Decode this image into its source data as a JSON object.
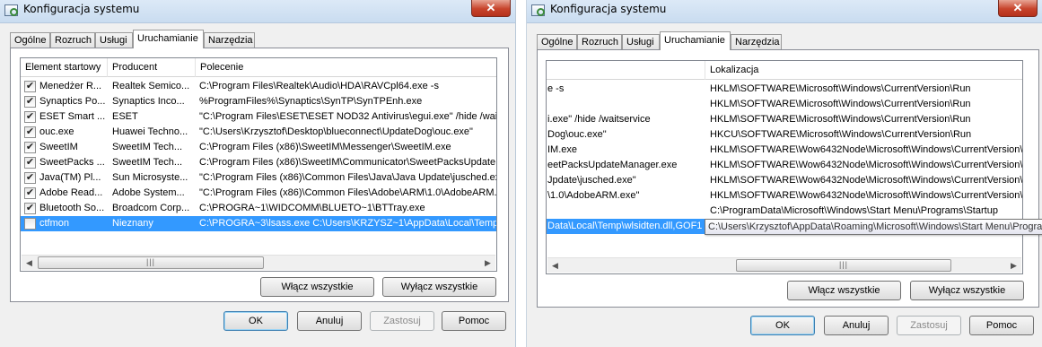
{
  "window": {
    "title": "Konfiguracja systemu",
    "close_glyph": "✕"
  },
  "tabs": [
    "Ogólne",
    "Rozruch",
    "Usługi",
    "Uruchamianie",
    "Narzędzia"
  ],
  "active_tab": "Uruchamianie",
  "columns": {
    "startup_item": "Element startowy",
    "manufacturer": "Producent",
    "command": "Polecenie",
    "location": "Lokalizacja"
  },
  "rows": [
    {
      "name": "Menedżer R...",
      "manufacturer": "Realtek Semico...",
      "command": "C:\\Program Files\\Realtek\\Audio\\HDA\\RAVCpl64.exe -s",
      "command_tail": "e -s",
      "location": "HKLM\\SOFTWARE\\Microsoft\\Windows\\CurrentVersion\\Run",
      "checked": true
    },
    {
      "name": "Synaptics Po...",
      "manufacturer": "Synaptics Inco...",
      "command": "%ProgramFiles%\\Synaptics\\SynTP\\SynTPEnh.exe",
      "command_tail": "",
      "location": "HKLM\\SOFTWARE\\Microsoft\\Windows\\CurrentVersion\\Run",
      "checked": true
    },
    {
      "name": "ESET Smart ...",
      "manufacturer": "ESET",
      "command": "\"C:\\Program Files\\ESET\\ESET NOD32 Antivirus\\egui.exe\" /hide /waits",
      "command_tail": "i.exe\" /hide /waitservice",
      "location": "HKLM\\SOFTWARE\\Microsoft\\Windows\\CurrentVersion\\Run",
      "checked": true
    },
    {
      "name": "ouc.exe",
      "manufacturer": "Huawei Techno...",
      "command": "\"C:\\Users\\Krzysztof\\Desktop\\blueconnect\\UpdateDog\\ouc.exe\"",
      "command_tail": "Dog\\ouc.exe\"",
      "location": "HKCU\\SOFTWARE\\Microsoft\\Windows\\CurrentVersion\\Run",
      "checked": true
    },
    {
      "name": "SweetIM",
      "manufacturer": "SweetIM Tech...",
      "command": "C:\\Program Files (x86)\\SweetIM\\Messenger\\SweetIM.exe",
      "command_tail": "IM.exe",
      "location": "HKLM\\SOFTWARE\\Wow6432Node\\Microsoft\\Windows\\CurrentVersion\\Ru",
      "checked": true
    },
    {
      "name": "SweetPacks ...",
      "manufacturer": "SweetIM Tech...",
      "command": "C:\\Program Files (x86)\\SweetIM\\Communicator\\SweetPacksUpdateM",
      "command_tail": "eetPacksUpdateManager.exe",
      "location": "HKLM\\SOFTWARE\\Wow6432Node\\Microsoft\\Windows\\CurrentVersion\\Ru",
      "checked": true
    },
    {
      "name": "Java(TM) Pl...",
      "manufacturer": "Sun Microsyste...",
      "command": "\"C:\\Program Files (x86)\\Common Files\\Java\\Java Update\\jusched.exe\"",
      "command_tail": "Jpdate\\jusched.exe\"",
      "location": "HKLM\\SOFTWARE\\Wow6432Node\\Microsoft\\Windows\\CurrentVersion\\Ru",
      "checked": true
    },
    {
      "name": "Adobe Read...",
      "manufacturer": "Adobe System...",
      "command": "\"C:\\Program Files (x86)\\Common Files\\Adobe\\ARM\\1.0\\AdobeARM.e",
      "command_tail": "\\1.0\\AdobeARM.exe\"",
      "location": "HKLM\\SOFTWARE\\Wow6432Node\\Microsoft\\Windows\\CurrentVersion\\Ru",
      "checked": true
    },
    {
      "name": "Bluetooth So...",
      "manufacturer": "Broadcom Corp...",
      "command": "C:\\PROGRA~1\\WIDCOMM\\BLUETO~1\\BTTray.exe",
      "command_tail": "",
      "location": "C:\\ProgramData\\Microsoft\\Windows\\Start Menu\\Programs\\Startup",
      "checked": true
    },
    {
      "name": "ctfmon",
      "manufacturer": "Nieznany",
      "command": "C:\\PROGRA~3\\lsass.exe C:\\Users\\KRZYSZ~1\\AppData\\Local\\Temp\\",
      "command_tail": "Data\\Local\\Temp\\wlsidten.dll,GOF1",
      "location": "",
      "checked": false
    }
  ],
  "tooltip": "C:\\Users\\Krzysztof\\AppData\\Roaming\\Microsoft\\Windows\\Start Menu\\Progra",
  "checkmark_glyph": "✔",
  "scroll_left_glyph": "◀",
  "scroll_right_glyph": "▶",
  "scroll_thumb_grip": "|||",
  "buttons": {
    "enable_all": "Włącz wszystkie",
    "disable_all": "Wyłącz wszystkie",
    "ok": "OK",
    "cancel": "Anuluj",
    "apply": "Zastosuj",
    "help": "Pomoc"
  }
}
